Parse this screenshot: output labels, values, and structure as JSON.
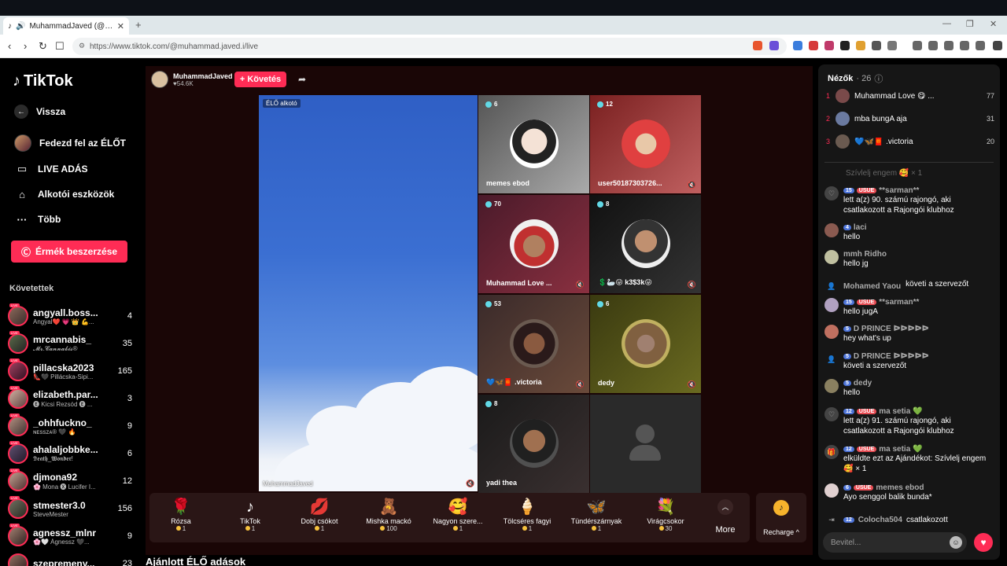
{
  "browser": {
    "tab_title": "MuhammadJaved (@muhamm...",
    "url": "https://www.tiktok.com/@muhammad.javed.i/live"
  },
  "sidebar": {
    "brand": "TikTok",
    "back": "Vissza",
    "items": [
      {
        "label": "Fedezd fel az ÉLŐT",
        "icon": "avatar-icon"
      },
      {
        "label": "LIVE ADÁS",
        "icon": "camera-icon"
      },
      {
        "label": "Alkotói eszközök",
        "icon": "home-icon"
      },
      {
        "label": "Több",
        "icon": "more-icon"
      }
    ],
    "coins_button": "Érmék beszerzése",
    "following_title": "Követettek",
    "following": [
      {
        "name": "angyall.boss...",
        "sub": "Angyal❤️ 💗 👑 💪...",
        "count": "4"
      },
      {
        "name": "mrcannabis_",
        "sub": "𝓜𝓻.𝓒𝓪𝓷𝓷𝓪𝓫𝓲𝓼®",
        "count": "35"
      },
      {
        "name": "pillacska2023",
        "sub": "👠🖤 Pillácska-Sipi...",
        "count": "165"
      },
      {
        "name": "elizabeth.par...",
        "sub": "🅔 Kicsi Rezsód 🅔 ...",
        "count": "3"
      },
      {
        "name": "_ohhfuckno_",
        "sub": "ɴᴇssᴢᴀ® 🖤 🔥",
        "count": "9"
      },
      {
        "name": "ahalaljobbke...",
        "sub": "𝕯𝖊𝖆𝖙𝖍_𝖂𝖔𝖓𝖉𝖊𝖗!",
        "count": "6"
      },
      {
        "name": "djmona92",
        "sub": "🌸 Mona 🅧 Lucifer I...",
        "count": "12"
      },
      {
        "name": "stmester3.0",
        "sub": "SteveMester",
        "count": "156"
      },
      {
        "name": "agnessz_mlnr",
        "sub": "🌸🤍 Ágnessz 🖤...",
        "count": "9"
      },
      {
        "name": "szepremeny...",
        "sub": "",
        "count": "23"
      }
    ]
  },
  "stream": {
    "host_name": "MuhammadJaved",
    "host_likes": "54.6K",
    "follow_label": "+ Követés",
    "creator_badge": "ÉLŐ alkotó",
    "main_name": "MuhammadJaved",
    "tiles": [
      {
        "count": "6",
        "name": "memes ebod"
      },
      {
        "count": "12",
        "name": "user50187303726..."
      },
      {
        "count": "70",
        "name": "Muhammad Love ..."
      },
      {
        "count": "8",
        "name": "💲🦢😜 k3$3k😜"
      },
      {
        "count": "53",
        "name": "💙🦋🧧 .victoria"
      },
      {
        "count": "6",
        "name": "dedy"
      },
      {
        "count": "8",
        "name": "yadi thea"
      },
      {
        "count": "",
        "name": ""
      }
    ]
  },
  "gifts": [
    {
      "name": "Rózsa",
      "price": "1",
      "icon": "🌹"
    },
    {
      "name": "TikTok",
      "price": "1",
      "icon": "♪"
    },
    {
      "name": "Dobj csókot",
      "price": "1",
      "icon": "💋"
    },
    {
      "name": "Mishka mackó",
      "price": "100",
      "icon": "🧸"
    },
    {
      "name": "Nagyon szere...",
      "price": "1",
      "icon": "🥰"
    },
    {
      "name": "Tölcséres fagyi",
      "price": "1",
      "icon": "🍦"
    },
    {
      "name": "Tündérszárnyak",
      "price": "1",
      "icon": "🦋"
    },
    {
      "name": "Virágcsokor",
      "price": "30",
      "icon": "💐"
    }
  ],
  "gift_more": "More",
  "recharge": "Recharge",
  "recommended": "Ajánlott ÉLŐ adások",
  "viewers": {
    "title": "Nézők",
    "count": "· 26",
    "list": [
      {
        "rank": "1",
        "name": "Muhammad Love 😋 ...",
        "score": "77"
      },
      {
        "rank": "2",
        "name": "mba bungA aja",
        "score": "31"
      },
      {
        "rank": "3",
        "name": "💙🦋🧧 .victoria",
        "score": "20"
      }
    ]
  },
  "chat": [
    {
      "level": "15",
      "use": "USUE",
      "user": "**sarman**",
      "msg": "lett a(z) 90. számú rajongó, aki csatlakozott a Rajongói klubhoz"
    },
    {
      "level": "4",
      "use": "",
      "user": "laci",
      "msg": "hello"
    },
    {
      "level": "",
      "use": "",
      "user": "mmh Ridho",
      "msg": "hello jg"
    },
    {
      "level": "",
      "use": "",
      "user": "Mohamed Yaou",
      "msg": "követi a szervezőt"
    },
    {
      "level": "15",
      "use": "USUE",
      "user": "**sarman**",
      "msg": "hello jugA"
    },
    {
      "level": "5",
      "use": "",
      "user": "D PRINCE ᐅᐅᐅᐅᐅ",
      "msg": "hey what's up"
    },
    {
      "level": "5",
      "use": "",
      "user": "D PRINCE ᐅᐅᐅᐅᐅ",
      "msg": "követi a szervezőt"
    },
    {
      "level": "5",
      "use": "",
      "user": "dedy",
      "msg": "hello"
    },
    {
      "level": "12",
      "use": "USUE",
      "user": "ma setia 💚",
      "msg": "lett a(z) 91. számú rajongó, aki csatlakozott a Rajongói klubhoz"
    },
    {
      "level": "12",
      "use": "USUE",
      "user": "ma setia 💚",
      "msg": "elküldte ezt az Ajándékot: Szívlelj engem 🥰 × 1"
    },
    {
      "level": "6",
      "use": "USUE",
      "user": "memes ebod",
      "msg": "Ayo senggol balik bunda*"
    },
    {
      "level": "12",
      "use": "",
      "user": "Colocha504",
      "msg": "csatlakozott"
    }
  ],
  "chat_faded": "Szívlelj engem 🥰 × 1",
  "chat_input_placeholder": "Bevitel..."
}
